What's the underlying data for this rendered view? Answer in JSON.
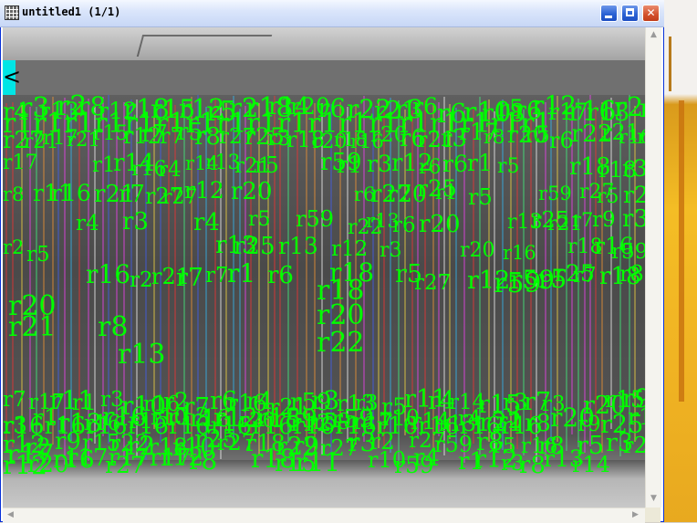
{
  "window": {
    "title": "untitled1 (1/1)",
    "icon": "grid-window-icon",
    "controls": {
      "minimize": "minimize-icon",
      "maximize": "maximize-icon",
      "close": "close-icon"
    }
  },
  "viewer": {
    "nav_left_glyph": "<",
    "scroll_up_glyph": "▲",
    "scroll_down_glyph": "▼",
    "scroll_left_glyph": "◀",
    "scroll_right_glyph": "▶",
    "label_color": "#00ff00",
    "band_accent": "#00e5e5",
    "line_colors": [
      "#ff3030",
      "#30c0ff",
      "#ffe040",
      "#ff40ff",
      "#40ff80",
      "#4060ff",
      "#ffffff",
      "#ff9a30"
    ],
    "labels": [
      "r1",
      "r2",
      "r3",
      "r4",
      "r5",
      "r6",
      "r7",
      "r8",
      "r9",
      "r10",
      "r11",
      "r12",
      "r13",
      "r14",
      "r15",
      "r16",
      "r17",
      "r18",
      "r20",
      "r21",
      "r22",
      "r25",
      "r27",
      "r59"
    ],
    "label_runs": [
      "r1r1r1r1r1r1r1r1r1r1r1r1r1r1r1r1r1r1",
      "r16r16r16r16r16r16r16r16r16r16r16r16r16",
      "r17r17r17"
    ]
  }
}
